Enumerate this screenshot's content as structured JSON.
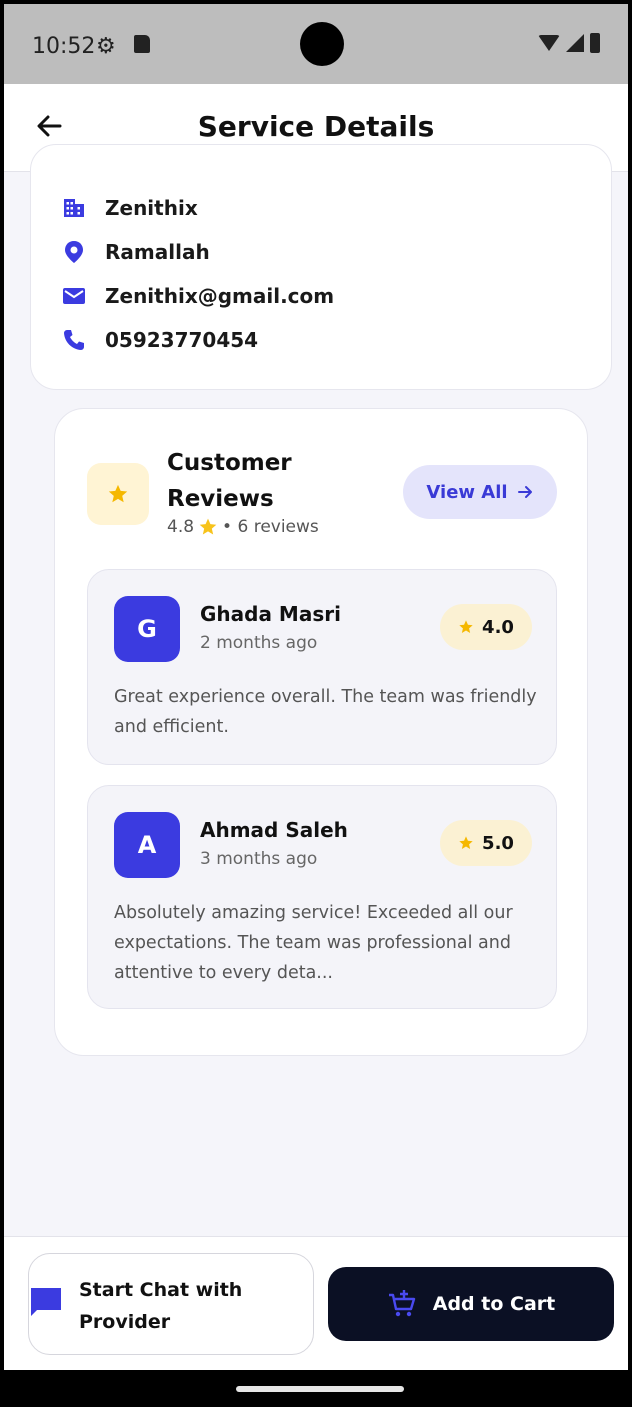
{
  "status_bar": {
    "time": "10:52"
  },
  "header": {
    "title": "Service Details"
  },
  "provider": {
    "company": "Zenithix",
    "location": "Ramallah",
    "email": "Zenithix@gmail.com",
    "phone": "05923770454"
  },
  "reviews": {
    "title": "Customer Reviews",
    "rating": "4.8",
    "count_text": "• 6 reviews",
    "view_all_label": "View All",
    "items": [
      {
        "initial": "G",
        "name": "Ghada Masri",
        "time": "2 months ago",
        "rating": "4.0",
        "text": "Great experience overall. The team was friendly and efficient."
      },
      {
        "initial": "A",
        "name": "Ahmad Saleh",
        "time": "3 months ago",
        "rating": "5.0",
        "text": "Absolutely amazing service! Exceeded all our expectations. The team was professional and attentive to every deta..."
      }
    ]
  },
  "actions": {
    "chat_label": "Start Chat with Provider",
    "cart_label": "Add to Cart"
  },
  "colors": {
    "accent": "#3b3be0",
    "star": "#f5b800",
    "dark_button": "#0b1024"
  }
}
